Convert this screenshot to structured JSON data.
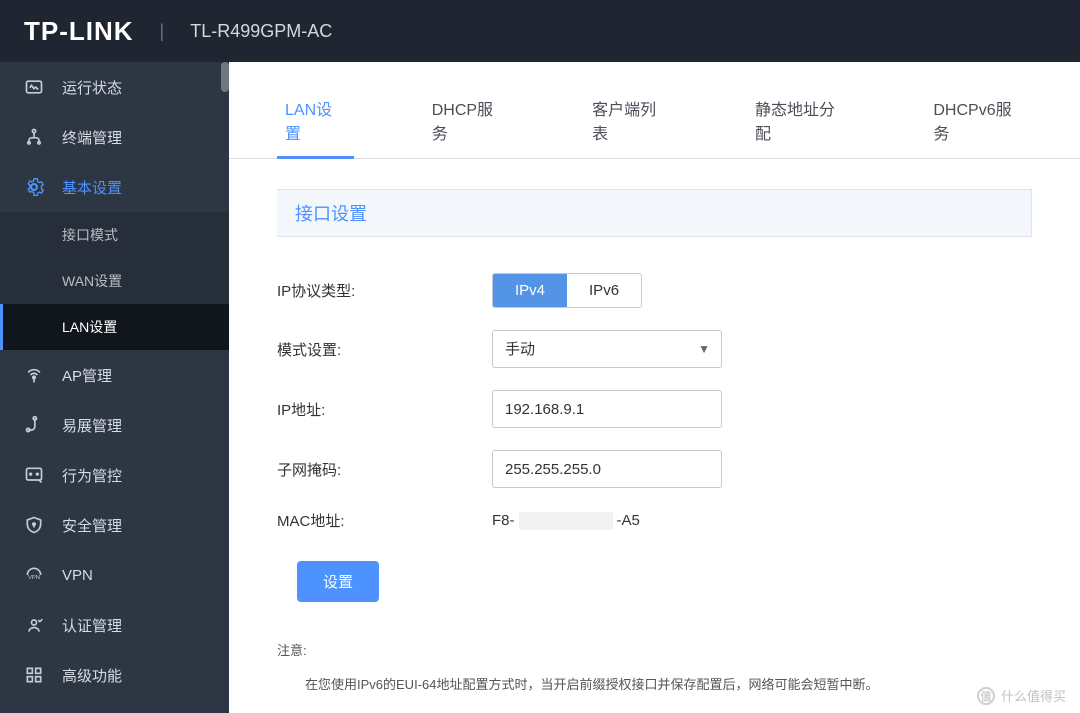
{
  "header": {
    "logo": "TP-LINK",
    "separator": "|",
    "model": "TL-R499GPM-AC"
  },
  "sidebar": {
    "items": [
      {
        "icon": "status-icon",
        "label": "运行状态"
      },
      {
        "icon": "terminal-icon",
        "label": "终端管理"
      },
      {
        "icon": "gear-icon",
        "label": "基本设置",
        "active": true,
        "children": [
          {
            "label": "接口模式"
          },
          {
            "label": "WAN设置"
          },
          {
            "label": "LAN设置",
            "selected": true
          }
        ]
      },
      {
        "icon": "antenna-icon",
        "label": "AP管理"
      },
      {
        "icon": "mesh-icon",
        "label": "易展管理"
      },
      {
        "icon": "behavior-icon",
        "label": "行为管控"
      },
      {
        "icon": "shield-icon",
        "label": "安全管理"
      },
      {
        "icon": "vpn-icon",
        "label": "VPN"
      },
      {
        "icon": "auth-icon",
        "label": "认证管理"
      },
      {
        "icon": "grid-icon",
        "label": "高级功能"
      }
    ]
  },
  "tabs": {
    "items": [
      {
        "label": "LAN设置",
        "active": true
      },
      {
        "label": "DHCP服务"
      },
      {
        "label": "客户端列表"
      },
      {
        "label": "静态地址分配"
      },
      {
        "label": "DHCPv6服务"
      }
    ]
  },
  "panel": {
    "title": "接口设置",
    "form": {
      "protocol_label": "IP协议类型:",
      "protocol_options": {
        "ipv4": "IPv4",
        "ipv6": "IPv6"
      },
      "protocol_active": "IPv4",
      "mode_label": "模式设置:",
      "mode_value": "手动",
      "ip_label": "IP地址:",
      "ip_value": "192.168.9.1",
      "mask_label": "子网掩码:",
      "mask_value": "255.255.255.0",
      "mac_label": "MAC地址:",
      "mac_prefix": "F8-",
      "mac_suffix": "-A5",
      "submit_label": "设置"
    },
    "note": {
      "title": "注意:",
      "body": "在您使用IPv6的EUI-64地址配置方式时，当开启前缀授权接口并保存配置后，网络可能会短暂中断。"
    }
  },
  "watermark": {
    "text": "什么值得买",
    "glyph": "值"
  }
}
